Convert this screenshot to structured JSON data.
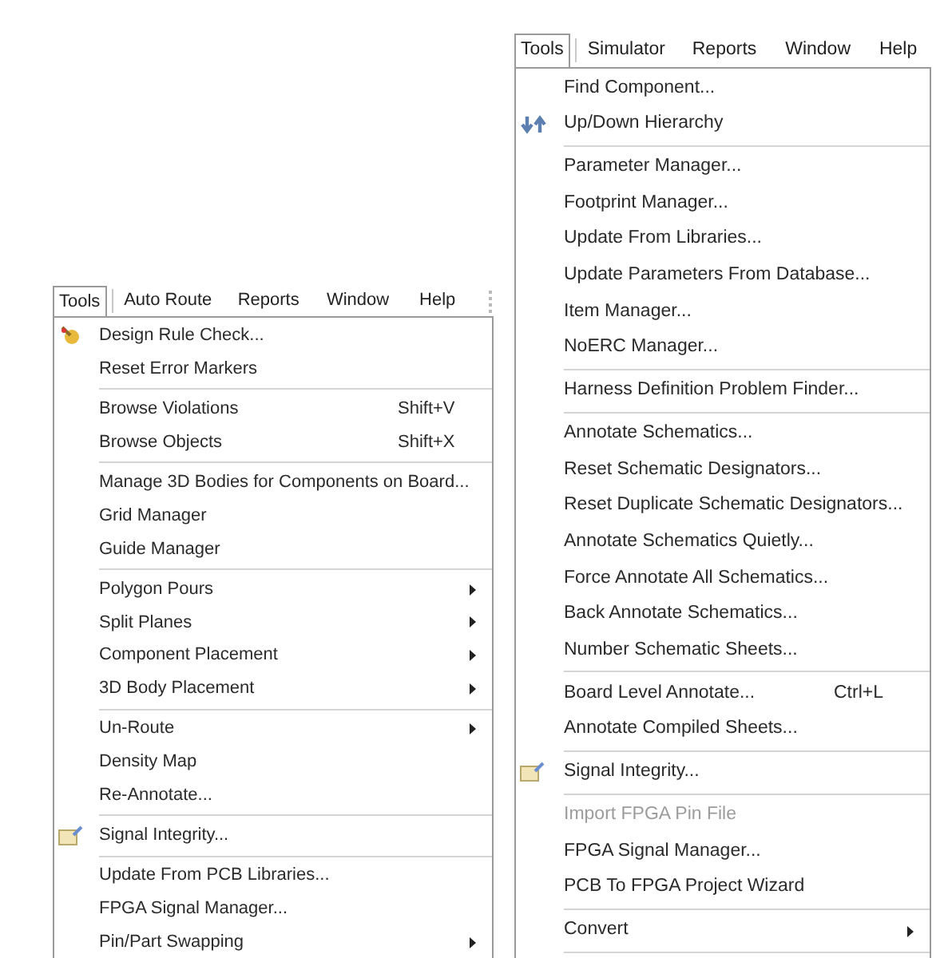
{
  "menus": [
    {
      "menubar": [
        {
          "label": "Tools",
          "selected": true
        },
        {
          "label": "Auto Route",
          "selected": false
        },
        {
          "label": "Reports",
          "selected": false
        },
        {
          "label": "Window",
          "selected": false
        },
        {
          "label": "Help",
          "selected": false
        }
      ],
      "items": [
        {
          "kind": "rule-check-item",
          "label": "Design Rule Check..."
        },
        {
          "kind": "item",
          "label": "Reset Error Markers"
        },
        {
          "kind": "separator"
        },
        {
          "kind": "item",
          "label": "Browse Violations",
          "shortcut": "Shift+V"
        },
        {
          "kind": "item",
          "label": "Browse Objects",
          "shortcut": "Shift+X"
        },
        {
          "kind": "separator"
        },
        {
          "kind": "item",
          "label": "Manage 3D Bodies for Components on Board..."
        },
        {
          "kind": "item",
          "label": "Grid Manager"
        },
        {
          "kind": "item",
          "label": "Guide Manager"
        },
        {
          "kind": "separator"
        },
        {
          "kind": "item",
          "label": "Polygon Pours",
          "submenu": true
        },
        {
          "kind": "item",
          "label": "Split Planes",
          "submenu": true
        },
        {
          "kind": "item",
          "label": "Component Placement",
          "submenu": true
        },
        {
          "kind": "item",
          "label": "3D Body Placement",
          "submenu": true
        },
        {
          "kind": "separator"
        },
        {
          "kind": "item",
          "label": "Un-Route",
          "submenu": true
        },
        {
          "kind": "item",
          "label": "Density Map"
        },
        {
          "kind": "item",
          "label": "Re-Annotate..."
        },
        {
          "kind": "separator"
        },
        {
          "kind": "signal-item",
          "label": "Signal Integrity..."
        },
        {
          "kind": "separator"
        },
        {
          "kind": "item",
          "label": "Update From PCB Libraries..."
        },
        {
          "kind": "item",
          "label": "FPGA Signal Manager..."
        },
        {
          "kind": "item",
          "label": "Pin/Part Swapping",
          "submenu": true
        }
      ]
    },
    {
      "menubar": [
        {
          "label": "Tools",
          "selected": true
        },
        {
          "label": "Simulator",
          "selected": false
        },
        {
          "label": "Reports",
          "selected": false
        },
        {
          "label": "Window",
          "selected": false
        },
        {
          "label": "Help",
          "selected": false
        }
      ],
      "items": [
        {
          "kind": "item",
          "label": "Find Component..."
        },
        {
          "kind": "hierarchy-item",
          "label": "Up/Down Hierarchy"
        },
        {
          "kind": "separator"
        },
        {
          "kind": "item",
          "label": "Parameter Manager..."
        },
        {
          "kind": "item",
          "label": "Footprint Manager..."
        },
        {
          "kind": "item",
          "label": "Update From Libraries..."
        },
        {
          "kind": "item",
          "label": "Update Parameters From Database..."
        },
        {
          "kind": "item",
          "label": "Item Manager..."
        },
        {
          "kind": "item",
          "label": "NoERC Manager..."
        },
        {
          "kind": "separator"
        },
        {
          "kind": "item",
          "label": "Harness Definition Problem Finder..."
        },
        {
          "kind": "separator"
        },
        {
          "kind": "item",
          "label": "Annotate Schematics..."
        },
        {
          "kind": "item",
          "label": "Reset Schematic Designators..."
        },
        {
          "kind": "item",
          "label": "Reset Duplicate Schematic Designators..."
        },
        {
          "kind": "item",
          "label": "Annotate Schematics Quietly..."
        },
        {
          "kind": "item",
          "label": "Force Annotate All Schematics..."
        },
        {
          "kind": "item",
          "label": "Back Annotate Schematics..."
        },
        {
          "kind": "item",
          "label": "Number Schematic Sheets..."
        },
        {
          "kind": "separator"
        },
        {
          "kind": "item",
          "label": "Board Level Annotate...",
          "shortcut": "Ctrl+L"
        },
        {
          "kind": "item",
          "label": "Annotate Compiled Sheets..."
        },
        {
          "kind": "separator"
        },
        {
          "kind": "signal-item",
          "label": "Signal Integrity..."
        },
        {
          "kind": "separator"
        },
        {
          "kind": "item",
          "label": "Import FPGA Pin File",
          "disabled": true
        },
        {
          "kind": "item",
          "label": "FPGA Signal Manager..."
        },
        {
          "kind": "item",
          "label": "PCB To FPGA Project Wizard"
        },
        {
          "kind": "separator"
        },
        {
          "kind": "item",
          "label": "Convert",
          "submenu": true
        },
        {
          "kind": "separator"
        }
      ]
    }
  ]
}
